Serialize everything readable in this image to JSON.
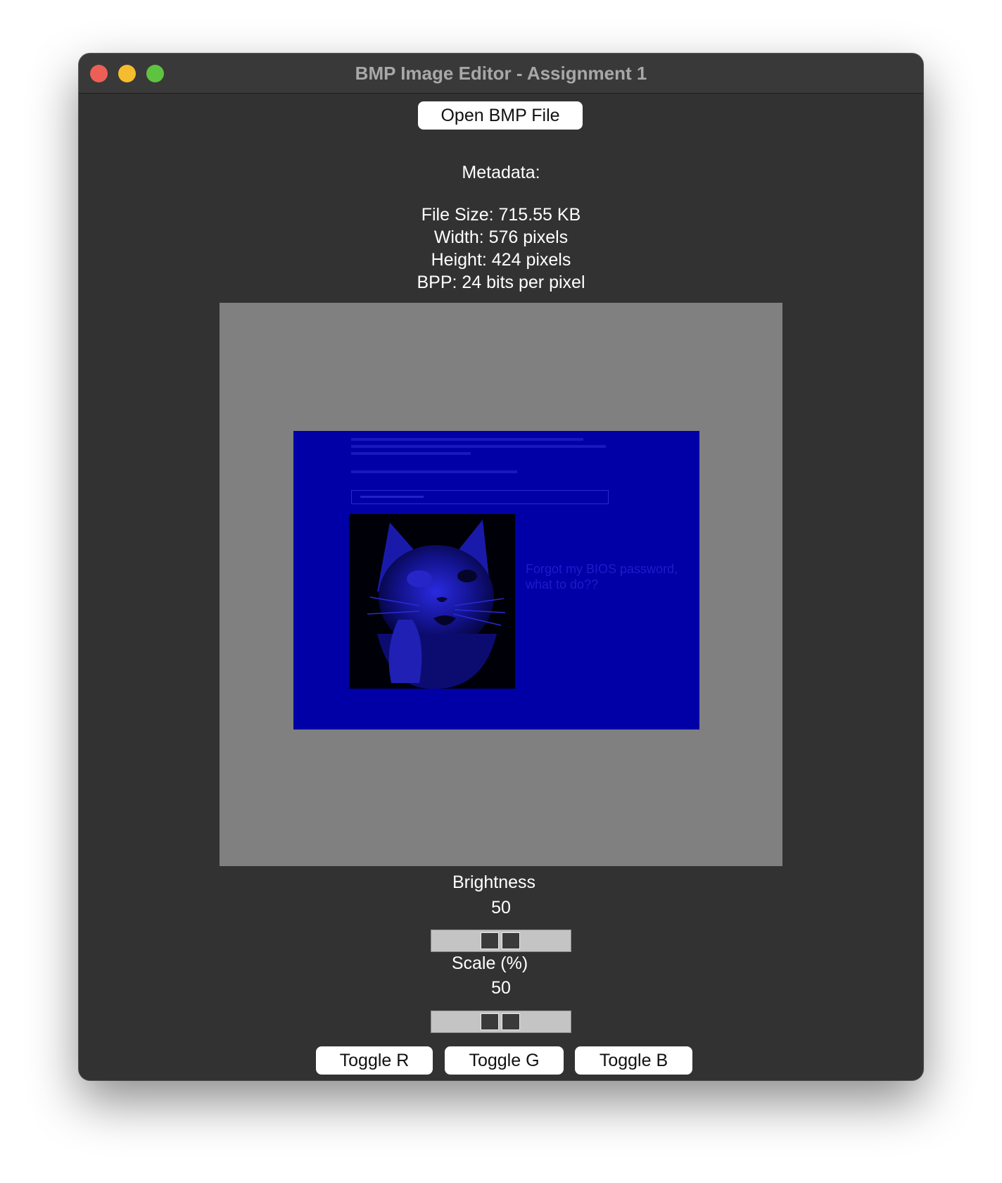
{
  "window": {
    "title": "BMP Image Editor - Assignment 1"
  },
  "toolbar": {
    "open_label": "Open BMP File"
  },
  "metadata": {
    "heading": "Metadata:",
    "file_size": "File Size: 715.55 KB",
    "width": "Width: 576 pixels",
    "height": "Height: 424 pixels",
    "bpp": "BPP: 24 bits per pixel"
  },
  "image": {
    "meme_line_1": "Forgot my BIOS password,",
    "meme_line_2": "what to do??",
    "tint_color": "#0000a6"
  },
  "controls": {
    "brightness_label": "Brightness",
    "brightness_value": "50",
    "scale_label": "Scale (%)",
    "scale_value": "50",
    "toggle_r": "Toggle R",
    "toggle_g": "Toggle G",
    "toggle_b": "Toggle B"
  }
}
